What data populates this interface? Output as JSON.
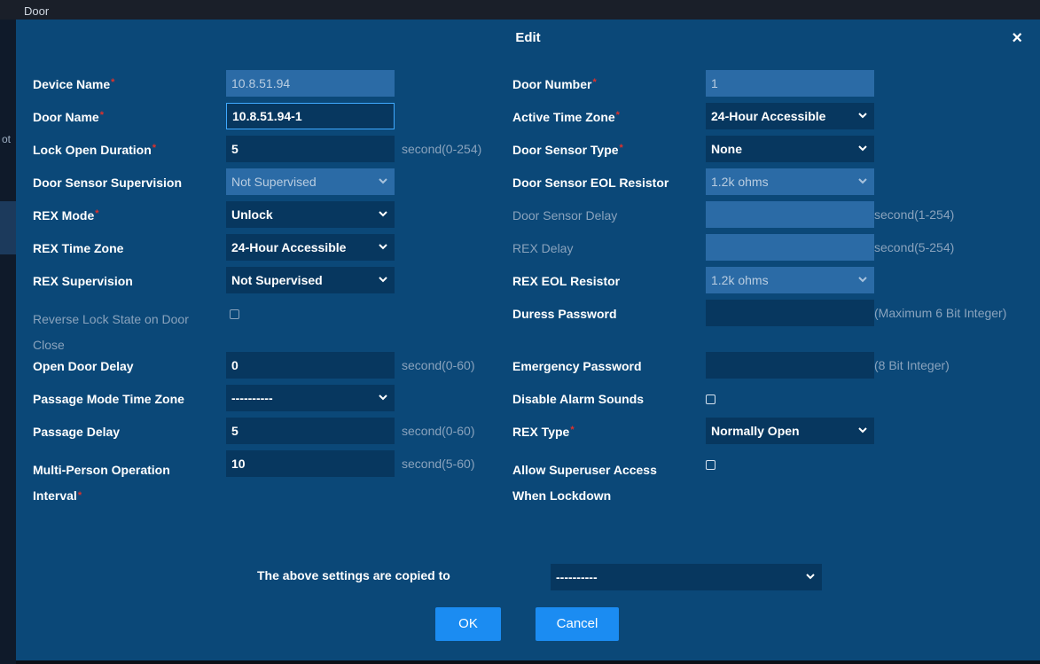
{
  "background": {
    "window_title": "Door",
    "side_text": "ot"
  },
  "dialog": {
    "title": "Edit",
    "close_symbol": "×",
    "required_mark": "*",
    "left": [
      {
        "key": "device_name",
        "label": "Device Name",
        "required": true,
        "value": "10.8.51.94",
        "kind": "text",
        "state": "disabled"
      },
      {
        "key": "door_name",
        "label": "Door Name",
        "required": true,
        "value": "10.8.51.94-1",
        "kind": "text",
        "state": "focused"
      },
      {
        "key": "lock_open_duration",
        "label": "Lock Open Duration",
        "required": true,
        "value": "5",
        "kind": "text",
        "state": "normal",
        "hint": "second(0-254)"
      },
      {
        "key": "door_sensor_supervision",
        "label": "Door Sensor Supervision",
        "required": false,
        "value": "Not Supervised",
        "kind": "select",
        "state": "disabled"
      },
      {
        "key": "rex_mode",
        "label": "REX Mode",
        "required": true,
        "value": "Unlock",
        "kind": "select",
        "state": "normal"
      },
      {
        "key": "rex_time_zone",
        "label": "REX Time Zone",
        "required": false,
        "value": "24-Hour Accessible",
        "kind": "select",
        "state": "normal"
      },
      {
        "key": "rex_supervision",
        "label": "REX Supervision",
        "required": false,
        "value": "Not Supervised",
        "kind": "select",
        "state": "normal"
      },
      {
        "key": "reverse_lock_state",
        "label_line1": "Reverse Lock State on Door",
        "label_line2": "Close",
        "required": false,
        "kind": "checkbox",
        "state": "disabled",
        "checked": false
      },
      {
        "key": "open_door_delay",
        "label": "Open Door Delay",
        "required": false,
        "value": "0",
        "kind": "text",
        "state": "normal",
        "hint": "second(0-60)"
      },
      {
        "key": "passage_mode_time_zone",
        "label": "Passage Mode Time Zone",
        "required": false,
        "value": "----------",
        "kind": "select",
        "state": "normal"
      },
      {
        "key": "passage_delay",
        "label": "Passage Delay",
        "required": false,
        "value": "5",
        "kind": "text",
        "state": "normal",
        "hint": "second(0-60)"
      },
      {
        "key": "multi_person_interval",
        "label_line1": "Multi-Person Operation",
        "label_line2": "Interval",
        "required": true,
        "value": "10",
        "kind": "text",
        "state": "normal",
        "hint": "second(5-60)"
      }
    ],
    "right": [
      {
        "key": "door_number",
        "label": "Door Number",
        "required": true,
        "value": "1",
        "kind": "text",
        "state": "disabled"
      },
      {
        "key": "active_time_zone",
        "label": "Active Time Zone",
        "required": true,
        "value": "24-Hour Accessible",
        "kind": "select",
        "state": "normal"
      },
      {
        "key": "door_sensor_type",
        "label": "Door Sensor Type",
        "required": true,
        "value": "None",
        "kind": "select",
        "state": "normal"
      },
      {
        "key": "door_sensor_eol",
        "label": "Door Sensor EOL Resistor",
        "required": false,
        "value": "1.2k ohms",
        "kind": "select",
        "state": "disabled"
      },
      {
        "key": "door_sensor_delay",
        "label": "Door Sensor Delay",
        "required": false,
        "value": "",
        "kind": "text",
        "state": "disabled",
        "label_disabled": true,
        "hint": "second(1-254)"
      },
      {
        "key": "rex_delay",
        "label": "REX Delay",
        "required": false,
        "value": "",
        "kind": "text",
        "state": "disabled",
        "label_disabled": true,
        "hint": "second(5-254)"
      },
      {
        "key": "rex_eol",
        "label": "REX EOL Resistor",
        "required": false,
        "value": "1.2k ohms",
        "kind": "select",
        "state": "disabled"
      },
      {
        "key": "duress_password",
        "label": "Duress Password",
        "required": false,
        "value": "",
        "kind": "text",
        "state": "normal",
        "hint": "(Maximum 6 Bit Integer)"
      },
      {
        "key": "emergency_password",
        "label": "Emergency Password",
        "required": false,
        "value": "",
        "kind": "text",
        "state": "normal",
        "hint": "(8 Bit Integer)"
      },
      {
        "key": "disable_alarm_sounds",
        "label": "Disable Alarm Sounds",
        "required": false,
        "kind": "checkbox",
        "state": "normal",
        "checked": false
      },
      {
        "key": "rex_type",
        "label": "REX Type",
        "required": true,
        "value": "Normally Open",
        "kind": "select",
        "state": "normal"
      },
      {
        "key": "allow_superuser",
        "label_line1": "Allow Superuser Access",
        "label_line2": "When Lockdown",
        "required": false,
        "kind": "checkbox",
        "state": "normal",
        "checked": false
      }
    ],
    "copy_to": {
      "label": "The above settings are copied to",
      "value": "----------"
    },
    "buttons": {
      "ok": "OK",
      "cancel": "Cancel"
    }
  }
}
